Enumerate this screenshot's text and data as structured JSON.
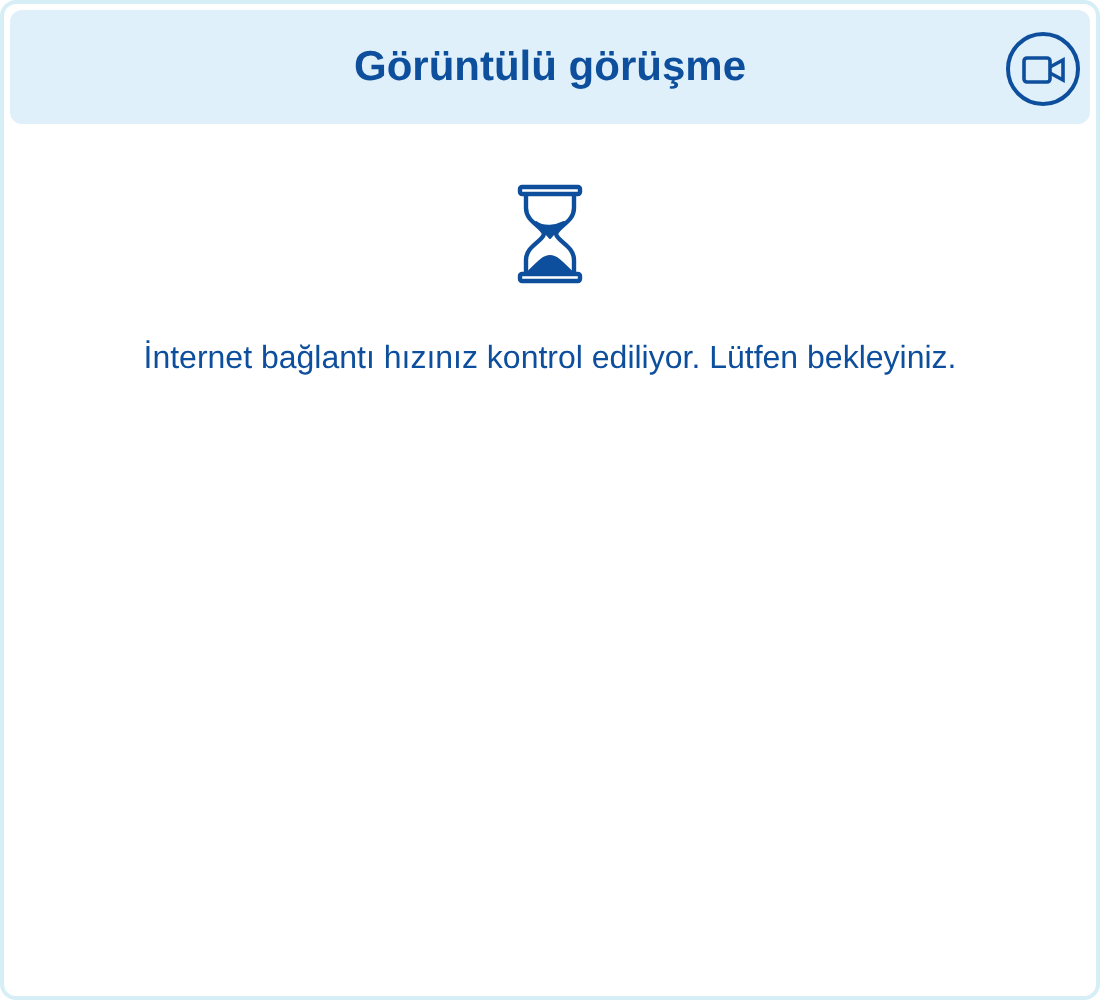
{
  "header": {
    "title": "Görüntülü görüşme"
  },
  "message": "İnternet bağlantı hızınız kontrol ediliyor. Lütfen bekleyiniz."
}
